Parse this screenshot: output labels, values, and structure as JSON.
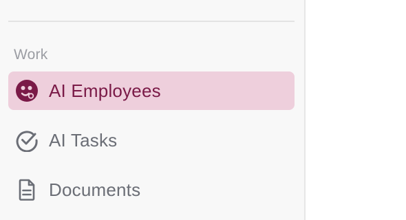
{
  "sidebar": {
    "section_label": "Work",
    "items": [
      {
        "label": "AI Employees",
        "icon": "ai-employee-icon",
        "active": true
      },
      {
        "label": "AI Tasks",
        "icon": "check-circle-icon",
        "active": false
      },
      {
        "label": "Documents",
        "icon": "document-icon",
        "active": false
      }
    ]
  },
  "colors": {
    "active_bg": "#eecfdc",
    "active_text": "#7a1a47",
    "inactive_text": "#6b6e76",
    "section_label": "#9b9da3"
  }
}
